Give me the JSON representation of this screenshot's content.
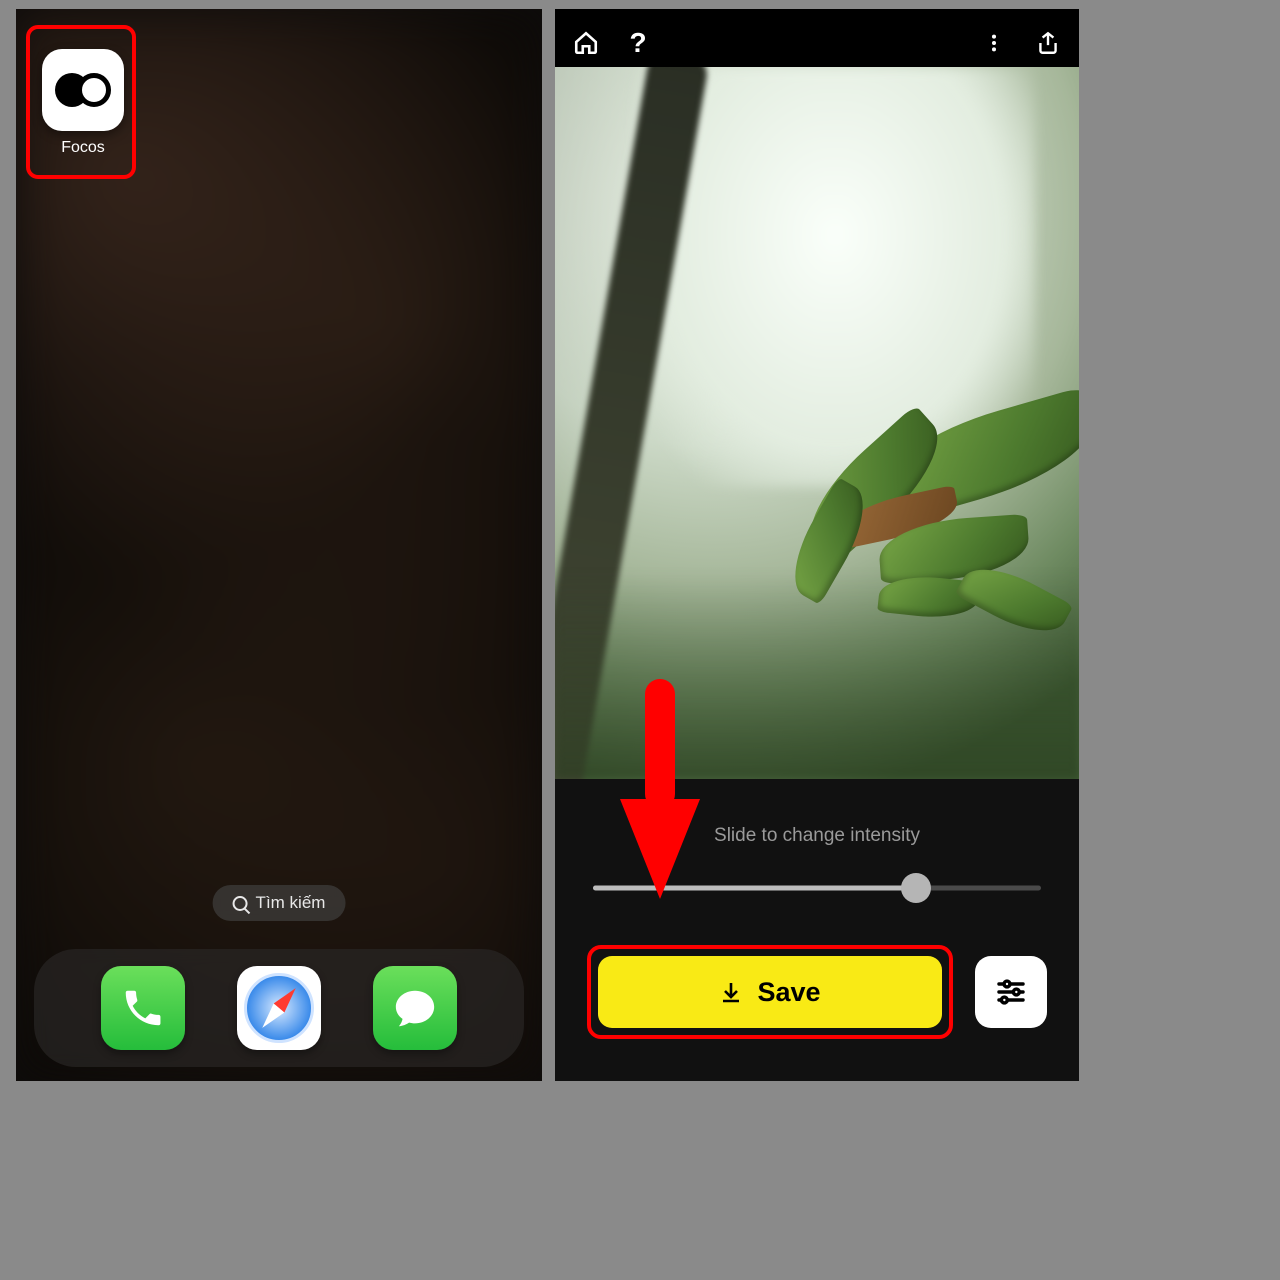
{
  "left": {
    "focos_app": {
      "label": "Focos"
    },
    "search_label": "Tìm kiếm",
    "dock": {
      "phone": "Phone",
      "safari": "Safari",
      "messages": "Messages"
    }
  },
  "right": {
    "slider_label": "Slide to change intensity",
    "slider_value_percent": 72,
    "save_label": "Save"
  },
  "annotations": {
    "focos_box": "red-highlight-focos",
    "save_box": "red-highlight-save",
    "red_arrow": "red-arrow-pointer"
  }
}
